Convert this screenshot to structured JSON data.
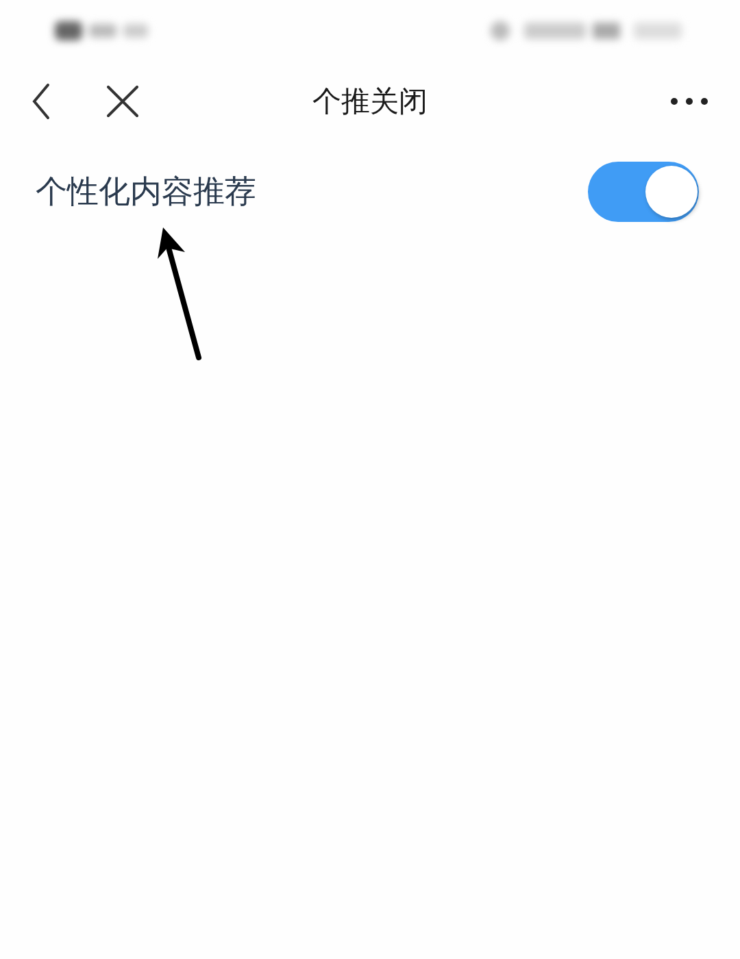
{
  "nav_bar": {
    "title": "个推关闭"
  },
  "settings": [
    {
      "label": "个性化内容推荐",
      "on": true
    }
  ]
}
